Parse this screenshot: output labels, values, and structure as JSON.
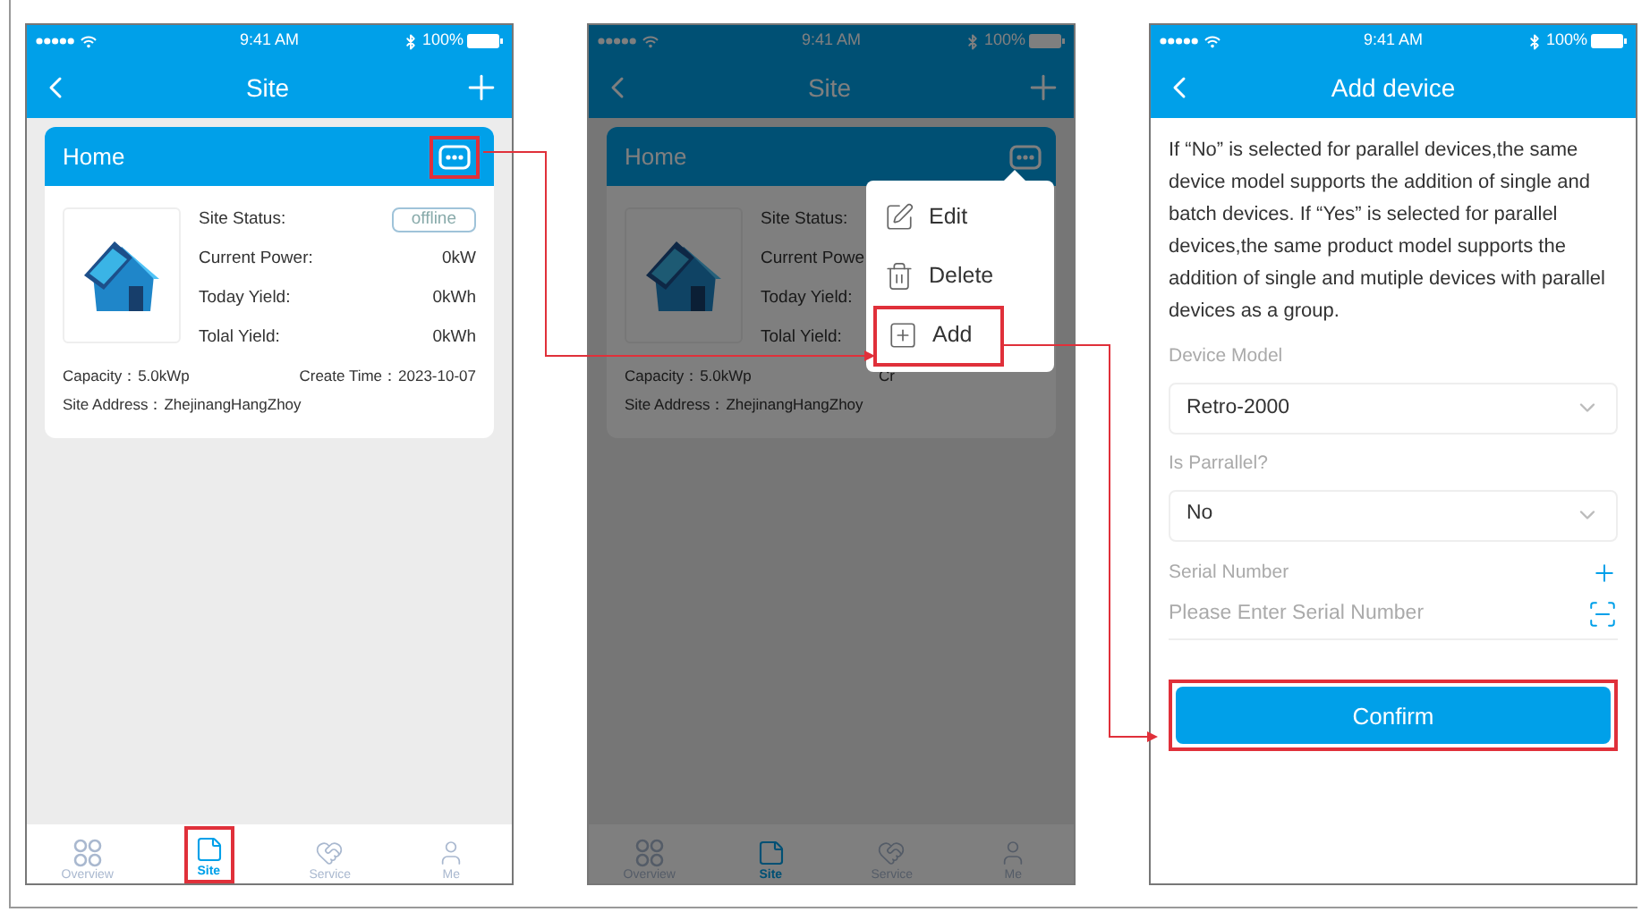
{
  "screens": [
    {
      "kind": "site",
      "status_bar": {
        "time": "9:41 AM",
        "battery": "100%"
      },
      "header": {
        "title": "Site"
      },
      "card": {
        "title": "Home",
        "more_highlighted": true,
        "rows": [
          {
            "label": "Site Status:",
            "value": "offline",
            "kind": "badge"
          },
          {
            "label": "Current Power:",
            "value": "0kW",
            "kind": "text"
          },
          {
            "label": "Today Yield:",
            "value": "0kWh",
            "kind": "text"
          },
          {
            "label": "Tolal Yield:",
            "value": "0kWh",
            "kind": "text"
          }
        ],
        "footer": [
          "Capacity：5.0kWp",
          "Create Time：2023-10-07"
        ],
        "address": "Site Address：ZhejinangHangZhoy"
      },
      "tab_bar": [
        {
          "label": "Overview",
          "selected": false,
          "highlighted": false
        },
        {
          "label": "Site",
          "selected": true,
          "highlighted": true
        },
        {
          "label": "Service",
          "selected": false,
          "highlighted": false
        },
        {
          "label": "Me",
          "selected": false,
          "highlighted": false
        }
      ]
    },
    {
      "kind": "site",
      "dimmed": true,
      "status_bar": {
        "time": "9:41 AM",
        "battery": "100%"
      },
      "header": {
        "title": "Site"
      },
      "card": {
        "title": "Home",
        "rows": [
          {
            "label": "Site Status:"
          },
          {
            "label": "Current Powe"
          },
          {
            "label": "Today Yield:"
          },
          {
            "label": "Tolal Yield:"
          }
        ],
        "footer": [
          "Capacity：5.0kWp",
          "Cr"
        ],
        "address": "Site Address：ZhejinangHangZhoy"
      },
      "menu": [
        {
          "label": "Edit",
          "kind": "edit",
          "highlighted": false
        },
        {
          "label": "Delete",
          "kind": "delete",
          "highlighted": false
        },
        {
          "label": "Add",
          "kind": "add",
          "highlighted": true
        }
      ],
      "tab_bar": [
        {
          "label": "Overview",
          "selected": false,
          "highlighted": false
        },
        {
          "label": "Site",
          "selected": true,
          "highlighted": false
        },
        {
          "label": "Service",
          "selected": false,
          "highlighted": false
        },
        {
          "label": "Me",
          "selected": false,
          "highlighted": false
        }
      ]
    },
    {
      "kind": "add_device",
      "status_bar": {
        "time": "9:41 AM",
        "battery": "100%"
      },
      "header": {
        "title": "Add device"
      },
      "intro": "If “No” is selected for parallel devices,the same device model supports the addition of single and batch devices. If “Yes” is selected for parallel devices,the same product model supports the addition of single and mutiple devices with parallel devices as a group.",
      "fields": [
        {
          "label": "Device Model",
          "value": "Retro-2000"
        },
        {
          "label": "Is Parrallel?",
          "value": "No"
        }
      ],
      "serial": {
        "label": "Serial Number",
        "placeholder": "Please Enter Serial Number"
      },
      "confirm": {
        "label": "Confirm",
        "highlighted": true
      }
    }
  ]
}
